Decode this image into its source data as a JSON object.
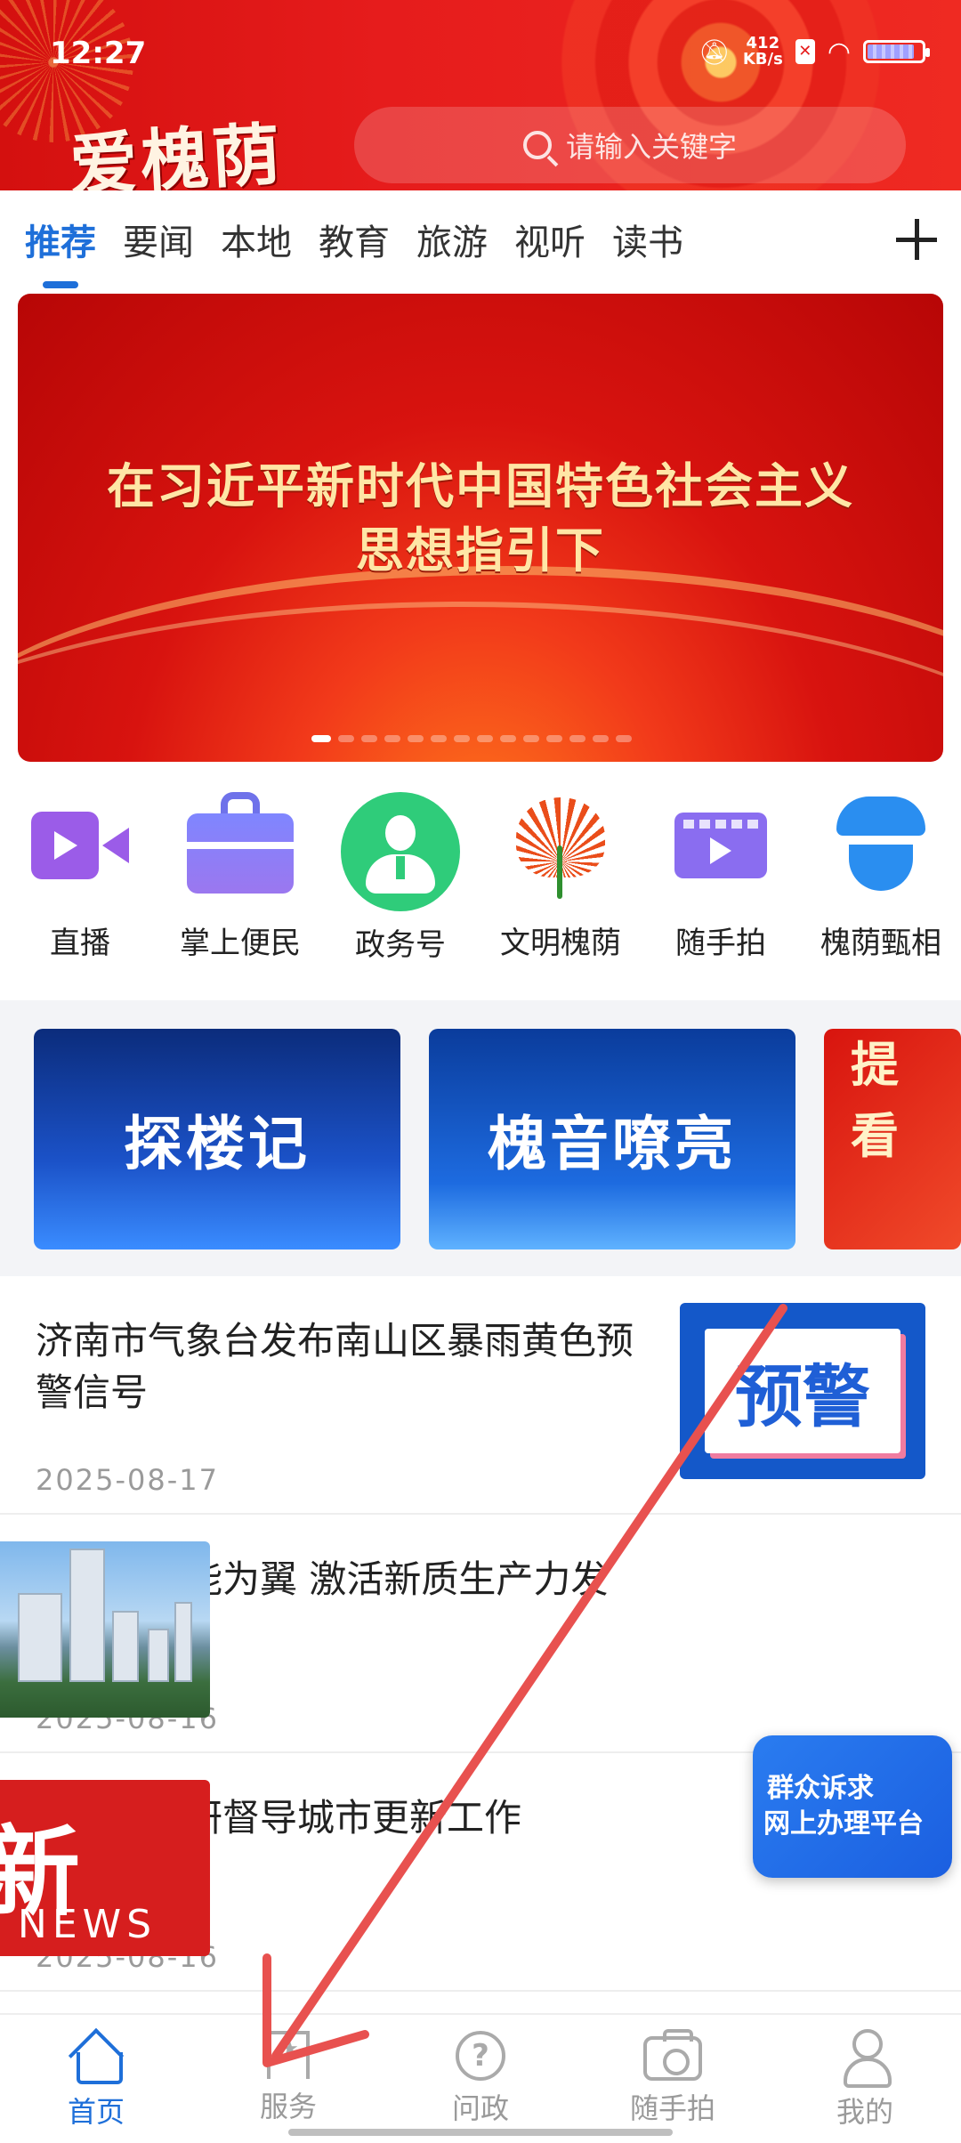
{
  "status_bar": {
    "time": "12:27",
    "speed_value": "412",
    "speed_unit": "KB/s"
  },
  "header": {
    "logo_text": "爱槐荫",
    "search_placeholder": "请输入关键字"
  },
  "tabs": [
    {
      "label": "推荐",
      "active": true
    },
    {
      "label": "要闻"
    },
    {
      "label": "本地"
    },
    {
      "label": "教育"
    },
    {
      "label": "旅游"
    },
    {
      "label": "视听"
    },
    {
      "label": "读书"
    }
  ],
  "banner": {
    "line1": "在习近平新时代中国特色社会主义",
    "line2": "思想指引下",
    "slide_count": 14,
    "active_slide": 1
  },
  "quick_links": [
    {
      "label": "直播",
      "icon": "live-video-icon"
    },
    {
      "label": "掌上便民",
      "icon": "briefcase-icon"
    },
    {
      "label": "政务号",
      "icon": "official-account-icon"
    },
    {
      "label": "文明槐荫",
      "icon": "civilization-flower-icon"
    },
    {
      "label": "随手拍",
      "icon": "video-play-icon"
    },
    {
      "label": "槐荫甄相",
      "icon": "police-icon"
    }
  ],
  "promos": [
    {
      "text": "探楼记"
    },
    {
      "text": "槐音嘹亮"
    },
    {
      "line1": "提",
      "line2": "看"
    }
  ],
  "news": [
    {
      "title": "济南市气象台发布南山区暴雨黄色预警信号",
      "date": "2025-08-17",
      "thumb_text": "预警"
    },
    {
      "title": "以人工智能为翼  激活新质生产力发展新动能",
      "date": "2025-08-16"
    },
    {
      "title": "孙常建调研督导城市更新工作",
      "date": "2025-08-16",
      "thumb_big": "新",
      "thumb_small": "NEWS"
    }
  ],
  "float_badge": {
    "line1": "群众诉求",
    "line2": "网上办理平台"
  },
  "bottom_nav": [
    {
      "label": "首页",
      "active": true,
      "icon": "home-icon"
    },
    {
      "label": "服务",
      "icon": "bookmark-star-icon"
    },
    {
      "label": "问政",
      "icon": "question-icon"
    },
    {
      "label": "随手拍",
      "icon": "camera-icon"
    },
    {
      "label": "我的",
      "icon": "user-icon"
    }
  ],
  "colors": {
    "brand_red": "#e61c1c",
    "accent_blue": "#1e6fd9",
    "arrow_red": "#e8514f"
  }
}
